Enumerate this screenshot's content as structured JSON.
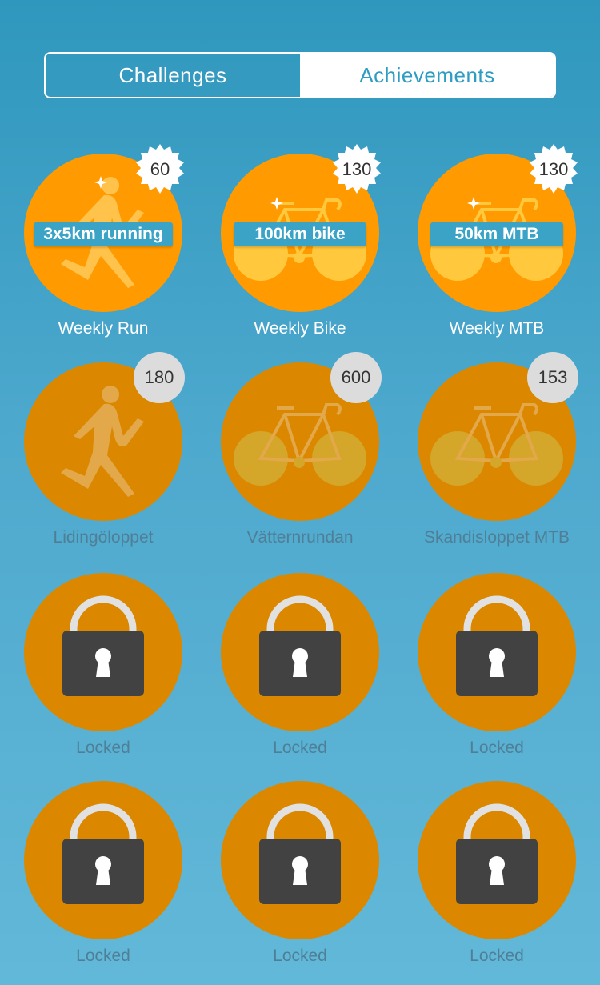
{
  "tabs": {
    "challenges": "Challenges",
    "achievements": "Achievements"
  },
  "colors": {
    "accent_blue": "#2f9cc2",
    "orange_active": "#ff9a00",
    "orange_dim": "#db8800",
    "lock_body": "#424242"
  },
  "row1": [
    {
      "label": "Weekly Run",
      "banner": "3x5km running",
      "points": "60",
      "icon": "runner-icon"
    },
    {
      "label": "Weekly Bike",
      "banner": "100km bike",
      "points": "130",
      "icon": "bike-icon"
    },
    {
      "label": "Weekly MTB",
      "banner": "50km MTB",
      "points": "130",
      "icon": "bike-icon"
    }
  ],
  "row2": [
    {
      "label": "Lidingöloppet",
      "points": "180",
      "icon": "runner-icon"
    },
    {
      "label": "Vätternrundan",
      "points": "600",
      "icon": "bike-icon"
    },
    {
      "label": "Skandisloppet MTB",
      "points": "153",
      "icon": "bike-icon"
    }
  ],
  "locked": {
    "label": "Locked",
    "icon": "padlock-icon"
  }
}
